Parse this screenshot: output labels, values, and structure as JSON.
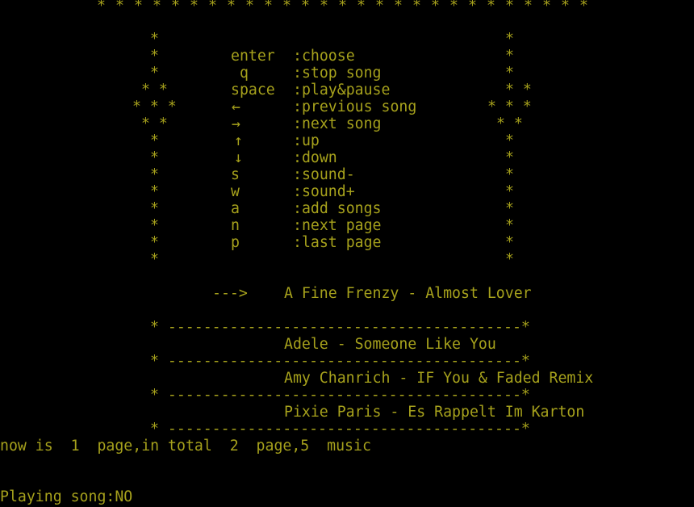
{
  "header": {
    "stars": "* * * * * * * * * * * * * * * * * * * * * * * * * * *"
  },
  "menu": {
    "items": [
      {
        "key": "enter",
        "desc": ":choose"
      },
      {
        "key": "q",
        "desc": ":stop song"
      },
      {
        "key": "space",
        "desc": ":play&pause"
      },
      {
        "key": "←",
        "desc": ":previous song"
      },
      {
        "key": "→",
        "desc": ":next song"
      },
      {
        "key": "↑",
        "desc": ":up"
      },
      {
        "key": "↓",
        "desc": ":down"
      },
      {
        "key": "s",
        "desc": ":sound-"
      },
      {
        "key": "w",
        "desc": ":sound+"
      },
      {
        "key": "a",
        "desc": ":add songs"
      },
      {
        "key": "n",
        "desc": ":next page"
      },
      {
        "key": "p",
        "desc": ":last page"
      }
    ],
    "frame": {
      "single": "*",
      "double": "* *",
      "triple": "* * *"
    }
  },
  "playlist": {
    "pointer": "--->",
    "selected": "A Fine Frenzy - Almost Lover",
    "separator": "* ----------------------------------------*",
    "songs": [
      "Adele - Someone Like You",
      "Amy Chanrich - IF You & Faded Remix",
      "Pixie Paris - Es Rappelt Im Karton"
    ]
  },
  "status": {
    "page_info": "now is  1  page,in total  2  page,5  music",
    "playing": "Playing song:NO"
  },
  "colors": {
    "background": "#000000",
    "text": "#a6a11c"
  }
}
